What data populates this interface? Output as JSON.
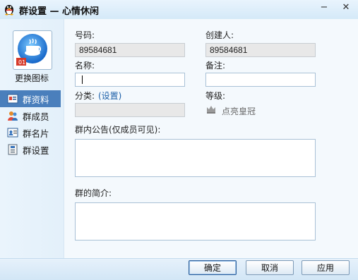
{
  "window": {
    "title": "群设置 — 心情休闲",
    "min_label": "−",
    "close_label": "✕"
  },
  "sidebar": {
    "change_icon_label": "更换图标",
    "avatar_badge": "01",
    "items": [
      {
        "label": "群资料",
        "icon": "group-profile-icon",
        "active": true
      },
      {
        "label": "群成员",
        "icon": "members-icon",
        "active": false
      },
      {
        "label": "群名片",
        "icon": "card-icon",
        "active": false
      },
      {
        "label": "群设置",
        "icon": "settings-icon",
        "active": false
      }
    ]
  },
  "form": {
    "number_label": "号码:",
    "number_value": "89584681",
    "creator_label": "创建人:",
    "creator_value": "89584681",
    "name_label": "名称:",
    "name_value": "",
    "remark_label": "备注:",
    "remark_value": "",
    "category_label": "分类:",
    "category_link": "(设置)",
    "category_value": "",
    "level_label": "等级:",
    "level_link": "点亮皇冠",
    "announcement_label": "群内公告(仅成员可见):",
    "announcement_value": "",
    "intro_label": "群的简介:",
    "intro_value": ""
  },
  "buttons": {
    "ok": "确定",
    "cancel": "取消",
    "apply": "应用"
  },
  "colors": {
    "accent": "#4a7fbc",
    "link": "#1b5fa8",
    "background": "#f4f9fd"
  }
}
